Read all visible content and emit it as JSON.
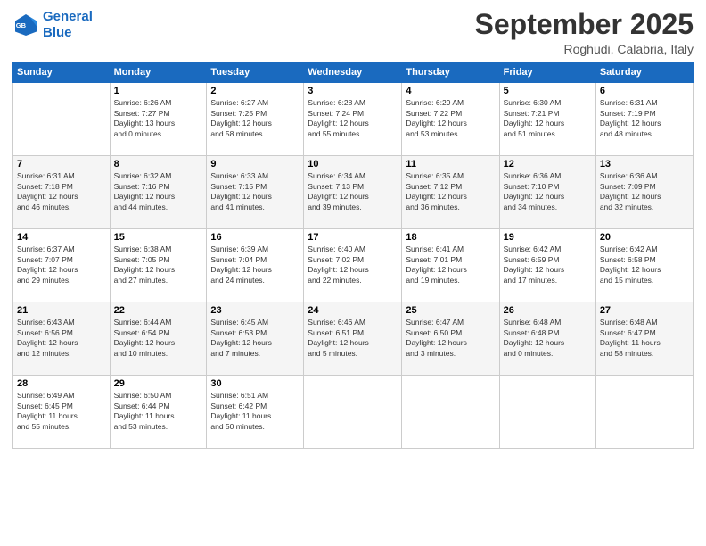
{
  "header": {
    "logo_line1": "General",
    "logo_line2": "Blue",
    "month": "September 2025",
    "location": "Roghudi, Calabria, Italy"
  },
  "weekdays": [
    "Sunday",
    "Monday",
    "Tuesday",
    "Wednesday",
    "Thursday",
    "Friday",
    "Saturday"
  ],
  "weeks": [
    [
      {
        "day": "",
        "text": ""
      },
      {
        "day": "1",
        "text": "Sunrise: 6:26 AM\nSunset: 7:27 PM\nDaylight: 13 hours\nand 0 minutes."
      },
      {
        "day": "2",
        "text": "Sunrise: 6:27 AM\nSunset: 7:25 PM\nDaylight: 12 hours\nand 58 minutes."
      },
      {
        "day": "3",
        "text": "Sunrise: 6:28 AM\nSunset: 7:24 PM\nDaylight: 12 hours\nand 55 minutes."
      },
      {
        "day": "4",
        "text": "Sunrise: 6:29 AM\nSunset: 7:22 PM\nDaylight: 12 hours\nand 53 minutes."
      },
      {
        "day": "5",
        "text": "Sunrise: 6:30 AM\nSunset: 7:21 PM\nDaylight: 12 hours\nand 51 minutes."
      },
      {
        "day": "6",
        "text": "Sunrise: 6:31 AM\nSunset: 7:19 PM\nDaylight: 12 hours\nand 48 minutes."
      }
    ],
    [
      {
        "day": "7",
        "text": "Sunrise: 6:31 AM\nSunset: 7:18 PM\nDaylight: 12 hours\nand 46 minutes."
      },
      {
        "day": "8",
        "text": "Sunrise: 6:32 AM\nSunset: 7:16 PM\nDaylight: 12 hours\nand 44 minutes."
      },
      {
        "day": "9",
        "text": "Sunrise: 6:33 AM\nSunset: 7:15 PM\nDaylight: 12 hours\nand 41 minutes."
      },
      {
        "day": "10",
        "text": "Sunrise: 6:34 AM\nSunset: 7:13 PM\nDaylight: 12 hours\nand 39 minutes."
      },
      {
        "day": "11",
        "text": "Sunrise: 6:35 AM\nSunset: 7:12 PM\nDaylight: 12 hours\nand 36 minutes."
      },
      {
        "day": "12",
        "text": "Sunrise: 6:36 AM\nSunset: 7:10 PM\nDaylight: 12 hours\nand 34 minutes."
      },
      {
        "day": "13",
        "text": "Sunrise: 6:36 AM\nSunset: 7:09 PM\nDaylight: 12 hours\nand 32 minutes."
      }
    ],
    [
      {
        "day": "14",
        "text": "Sunrise: 6:37 AM\nSunset: 7:07 PM\nDaylight: 12 hours\nand 29 minutes."
      },
      {
        "day": "15",
        "text": "Sunrise: 6:38 AM\nSunset: 7:05 PM\nDaylight: 12 hours\nand 27 minutes."
      },
      {
        "day": "16",
        "text": "Sunrise: 6:39 AM\nSunset: 7:04 PM\nDaylight: 12 hours\nand 24 minutes."
      },
      {
        "day": "17",
        "text": "Sunrise: 6:40 AM\nSunset: 7:02 PM\nDaylight: 12 hours\nand 22 minutes."
      },
      {
        "day": "18",
        "text": "Sunrise: 6:41 AM\nSunset: 7:01 PM\nDaylight: 12 hours\nand 19 minutes."
      },
      {
        "day": "19",
        "text": "Sunrise: 6:42 AM\nSunset: 6:59 PM\nDaylight: 12 hours\nand 17 minutes."
      },
      {
        "day": "20",
        "text": "Sunrise: 6:42 AM\nSunset: 6:58 PM\nDaylight: 12 hours\nand 15 minutes."
      }
    ],
    [
      {
        "day": "21",
        "text": "Sunrise: 6:43 AM\nSunset: 6:56 PM\nDaylight: 12 hours\nand 12 minutes."
      },
      {
        "day": "22",
        "text": "Sunrise: 6:44 AM\nSunset: 6:54 PM\nDaylight: 12 hours\nand 10 minutes."
      },
      {
        "day": "23",
        "text": "Sunrise: 6:45 AM\nSunset: 6:53 PM\nDaylight: 12 hours\nand 7 minutes."
      },
      {
        "day": "24",
        "text": "Sunrise: 6:46 AM\nSunset: 6:51 PM\nDaylight: 12 hours\nand 5 minutes."
      },
      {
        "day": "25",
        "text": "Sunrise: 6:47 AM\nSunset: 6:50 PM\nDaylight: 12 hours\nand 3 minutes."
      },
      {
        "day": "26",
        "text": "Sunrise: 6:48 AM\nSunset: 6:48 PM\nDaylight: 12 hours\nand 0 minutes."
      },
      {
        "day": "27",
        "text": "Sunrise: 6:48 AM\nSunset: 6:47 PM\nDaylight: 11 hours\nand 58 minutes."
      }
    ],
    [
      {
        "day": "28",
        "text": "Sunrise: 6:49 AM\nSunset: 6:45 PM\nDaylight: 11 hours\nand 55 minutes."
      },
      {
        "day": "29",
        "text": "Sunrise: 6:50 AM\nSunset: 6:44 PM\nDaylight: 11 hours\nand 53 minutes."
      },
      {
        "day": "30",
        "text": "Sunrise: 6:51 AM\nSunset: 6:42 PM\nDaylight: 11 hours\nand 50 minutes."
      },
      {
        "day": "",
        "text": ""
      },
      {
        "day": "",
        "text": ""
      },
      {
        "day": "",
        "text": ""
      },
      {
        "day": "",
        "text": ""
      }
    ]
  ]
}
